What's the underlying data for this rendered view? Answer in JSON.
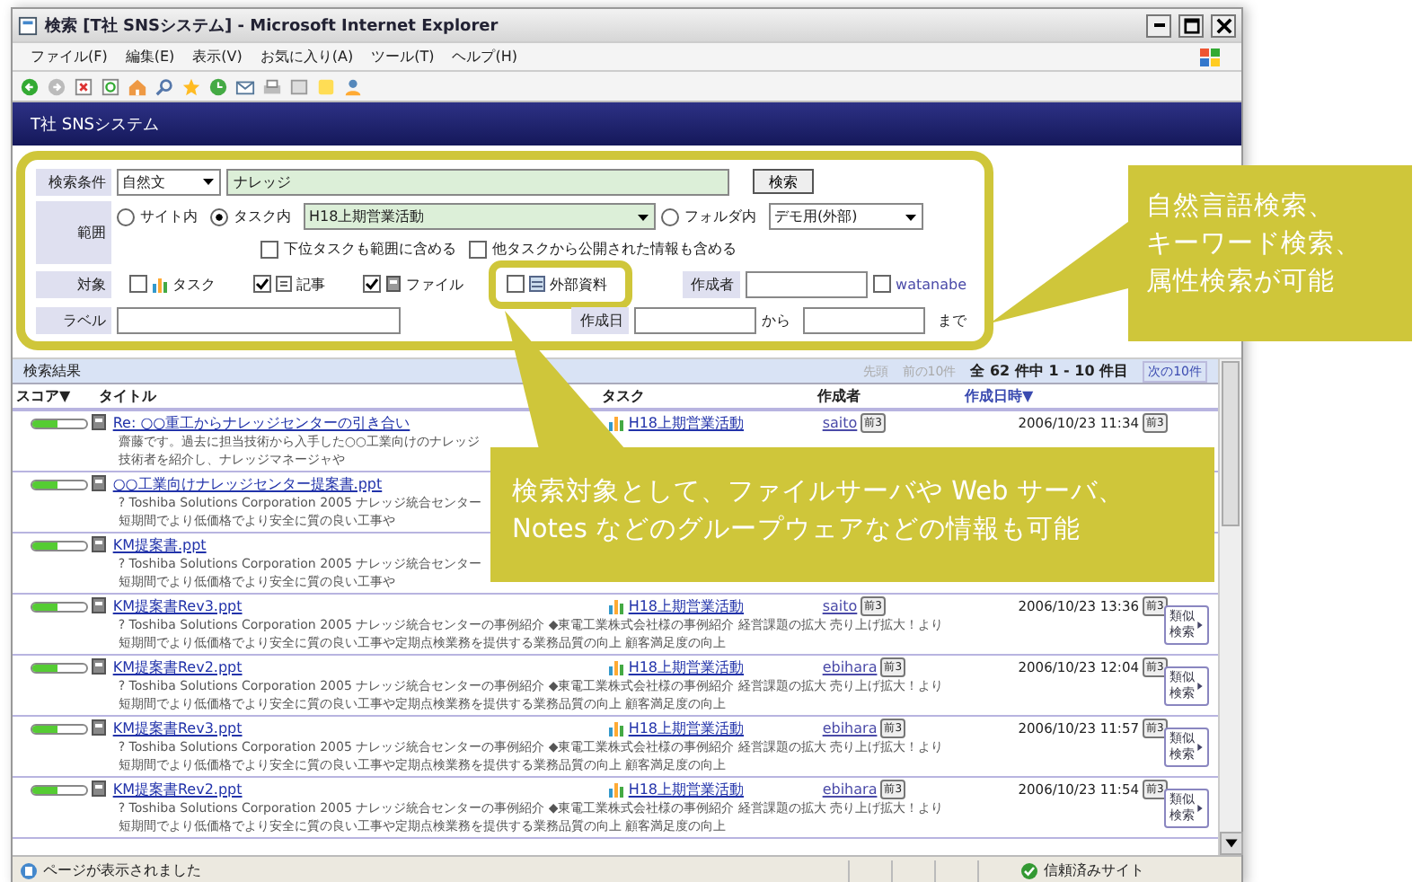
{
  "window": {
    "title": "検索 [T社 SNSシステム] - Microsoft Internet Explorer"
  },
  "menu": [
    "ファイル(F)",
    "編集(E)",
    "表示(V)",
    "お気に入り(A)",
    "ツール(T)",
    "ヘルプ(H)"
  ],
  "app_title": "T社 SNSシステム",
  "search": {
    "highlighted": true,
    "label": "検索条件",
    "mode": "自然文",
    "query": "ナレッジ",
    "button": "検索",
    "scope_label": "範囲",
    "scopes": [
      {
        "label": "サイト内",
        "selected": false
      },
      {
        "label": "タスク内",
        "selected": true,
        "value": "H18上期営業活動"
      },
      {
        "label": "フォルダ内",
        "selected": false,
        "value": "デモ用(外部)"
      }
    ],
    "options": [
      {
        "label": "下位タスクも範囲に含める",
        "checked": false
      },
      {
        "label": "他タスクから公開された情報も含める",
        "checked": false
      }
    ],
    "target_label": "対象",
    "targets": [
      {
        "kind": "task",
        "label": "タスク",
        "checked": false,
        "highlighted": false
      },
      {
        "kind": "article",
        "label": "記事",
        "checked": true,
        "highlighted": false
      },
      {
        "kind": "file",
        "label": "ファイル",
        "checked": true,
        "highlighted": false
      },
      {
        "kind": "external",
        "label": "外部資料",
        "checked": false,
        "highlighted": true
      }
    ],
    "author_label": "作成者",
    "author_option": {
      "label": "watanabe",
      "checked": false
    },
    "label_label": "ラベル",
    "date_label": "作成日",
    "date_from": "から",
    "date_to": "まで"
  },
  "results": {
    "title": "検索結果",
    "first": "先頭",
    "prev": "前の10件",
    "count": "全 62 件中 1 - 10 件目",
    "next": "次の10件",
    "columns": [
      "スコア▼",
      "タイトル",
      "タスク",
      "作成者",
      "作成日時▼"
    ],
    "rows": [
      {
        "level": 0.45,
        "title": "Re: ○○重工からナレッジセンターの引き合い",
        "task": "H18上期営業活動",
        "author": "saito",
        "author_badge": "前3",
        "date": "2006/10/23 11:34",
        "date_badge": "前3",
        "snippet": [
          "齋藤です。過去に担当技術から入手した○○工業向けのナレッジ",
          "技術者を紹介し、ナレッジマネージャや"
        ]
      },
      {
        "level": 0.45,
        "title": "○○工業向けナレッジセンター提案書.ppt",
        "snippet": [
          "? Toshiba Solutions Corporation 2005 ナレッジ統合センター",
          "短期間でより低価格でより安全に質の良い工事や"
        ]
      },
      {
        "level": 0.45,
        "title": "KM提案書.ppt",
        "snippet": [
          "? Toshiba Solutions Corporation 2005 ナレッジ統合センター",
          "短期間でより低価格でより安全に質の良い工事や"
        ]
      },
      {
        "level": 0.45,
        "title": "KM提案書Rev3.ppt",
        "task": "H18上期営業活動",
        "author": "saito",
        "author_badge": "前3",
        "date": "2006/10/23 13:36",
        "date_badge": "前3",
        "similar": "類似検索",
        "snippet": [
          "? Toshiba Solutions Corporation 2005 ナレッジ統合センターの事例紹介 ◆東電工業株式会社様の事例紹介 経営課題の拡大 売り上げ拡大！より",
          "短期間でより低価格でより安全に質の良い工事や定期点検業務を提供する業務品質の向上 顧客満足度の向上"
        ]
      },
      {
        "level": 0.45,
        "title": "KM提案書Rev2.ppt",
        "task": "H18上期営業活動",
        "author": "ebihara",
        "author_badge": "前3",
        "date": "2006/10/23 12:04",
        "date_badge": "前3",
        "similar": "類似検索",
        "snippet": [
          "? Toshiba Solutions Corporation 2005 ナレッジ統合センターの事例紹介 ◆東電工業株式会社様の事例紹介 経営課題の拡大 売り上げ拡大！より",
          "短期間でより低価格でより安全に質の良い工事や定期点検業務を提供する業務品質の向上 顧客満足度の向上"
        ]
      },
      {
        "level": 0.45,
        "title": "KM提案書Rev3.ppt",
        "task": "H18上期営業活動",
        "author": "ebihara",
        "author_badge": "前3",
        "date": "2006/10/23 11:57",
        "date_badge": "前3",
        "similar": "類似検索",
        "snippet": [
          "? Toshiba Solutions Corporation 2005 ナレッジ統合センターの事例紹介 ◆東電工業株式会社様の事例紹介 経営課題の拡大 売り上げ拡大！より",
          "短期間でより低価格でより安全に質の良い工事や定期点検業務を提供する業務品質の向上 顧客満足度の向上"
        ]
      },
      {
        "level": 0.45,
        "title": "KM提案書Rev2.ppt",
        "task": "H18上期営業活動",
        "author": "ebihara",
        "author_badge": "前3",
        "date": "2006/10/23 11:54",
        "date_badge": "前3",
        "similar": "類似検索",
        "snippet": [
          "? Toshiba Solutions Corporation 2005 ナレッジ統合センターの事例紹介 ◆東電工業株式会社様の事例紹介 経営課題の拡大 売り上げ拡大！より",
          "短期間でより低価格でより安全に質の良い工事や定期点検業務を提供する業務品質の向上 顧客満足度の向上"
        ]
      }
    ]
  },
  "status_bar": {
    "message": "ページが表示されました",
    "zone": "信頼済みサイト"
  },
  "callouts": [
    {
      "lines": [
        "自然言語検索、",
        "キーワード検索、",
        "属性検索が可能"
      ]
    },
    {
      "lines": [
        "検索対象として、ファイルサーバや Web サーバ、",
        "Notes などのグループウェアなどの情報も可能"
      ]
    }
  ]
}
